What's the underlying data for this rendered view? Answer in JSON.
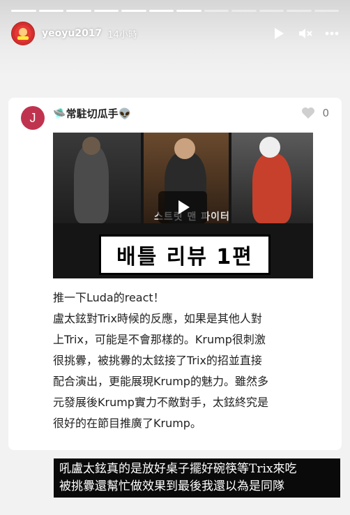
{
  "story": {
    "progress": {
      "total_segments": 12,
      "completed_segments": 7
    },
    "username": "yeoyu2017",
    "time_ago": "14小時",
    "controls": {
      "play_icon": "play-icon",
      "mute_icon": "speaker-muted-icon",
      "more_icon": "more-icon"
    }
  },
  "post": {
    "avatar_letter": "J",
    "author": "🛸常駐切瓜手👽",
    "like_count": "0",
    "video": {
      "title": "배틀 리뷰 1편",
      "logo_text": "스트릿 맨 파이터"
    },
    "body_lines": [
      "推一下Luda的react！",
      "盧太鉉對Trix時候的反應，如果是其他人對",
      "上Trix，可能是不會那樣的。Krump很刺激",
      "很挑釁，被挑釁的太鉉接了Trix的招並直接",
      "配合演出，更能展現Krump的魅力。雖然多",
      "元發展後Krump實力不敵對手，太鉉終究是",
      "很好的在節目推廣了Krump。"
    ]
  },
  "subtitles": {
    "line1": "吼盧太鉉真的是放好桌子擺好碗筷等Trix來吃",
    "line2": "被挑釁還幫忙做效果到最後我還以為是同隊"
  },
  "colors": {
    "avatar": "#c0334e",
    "story_avatar": "#d32f2f"
  }
}
